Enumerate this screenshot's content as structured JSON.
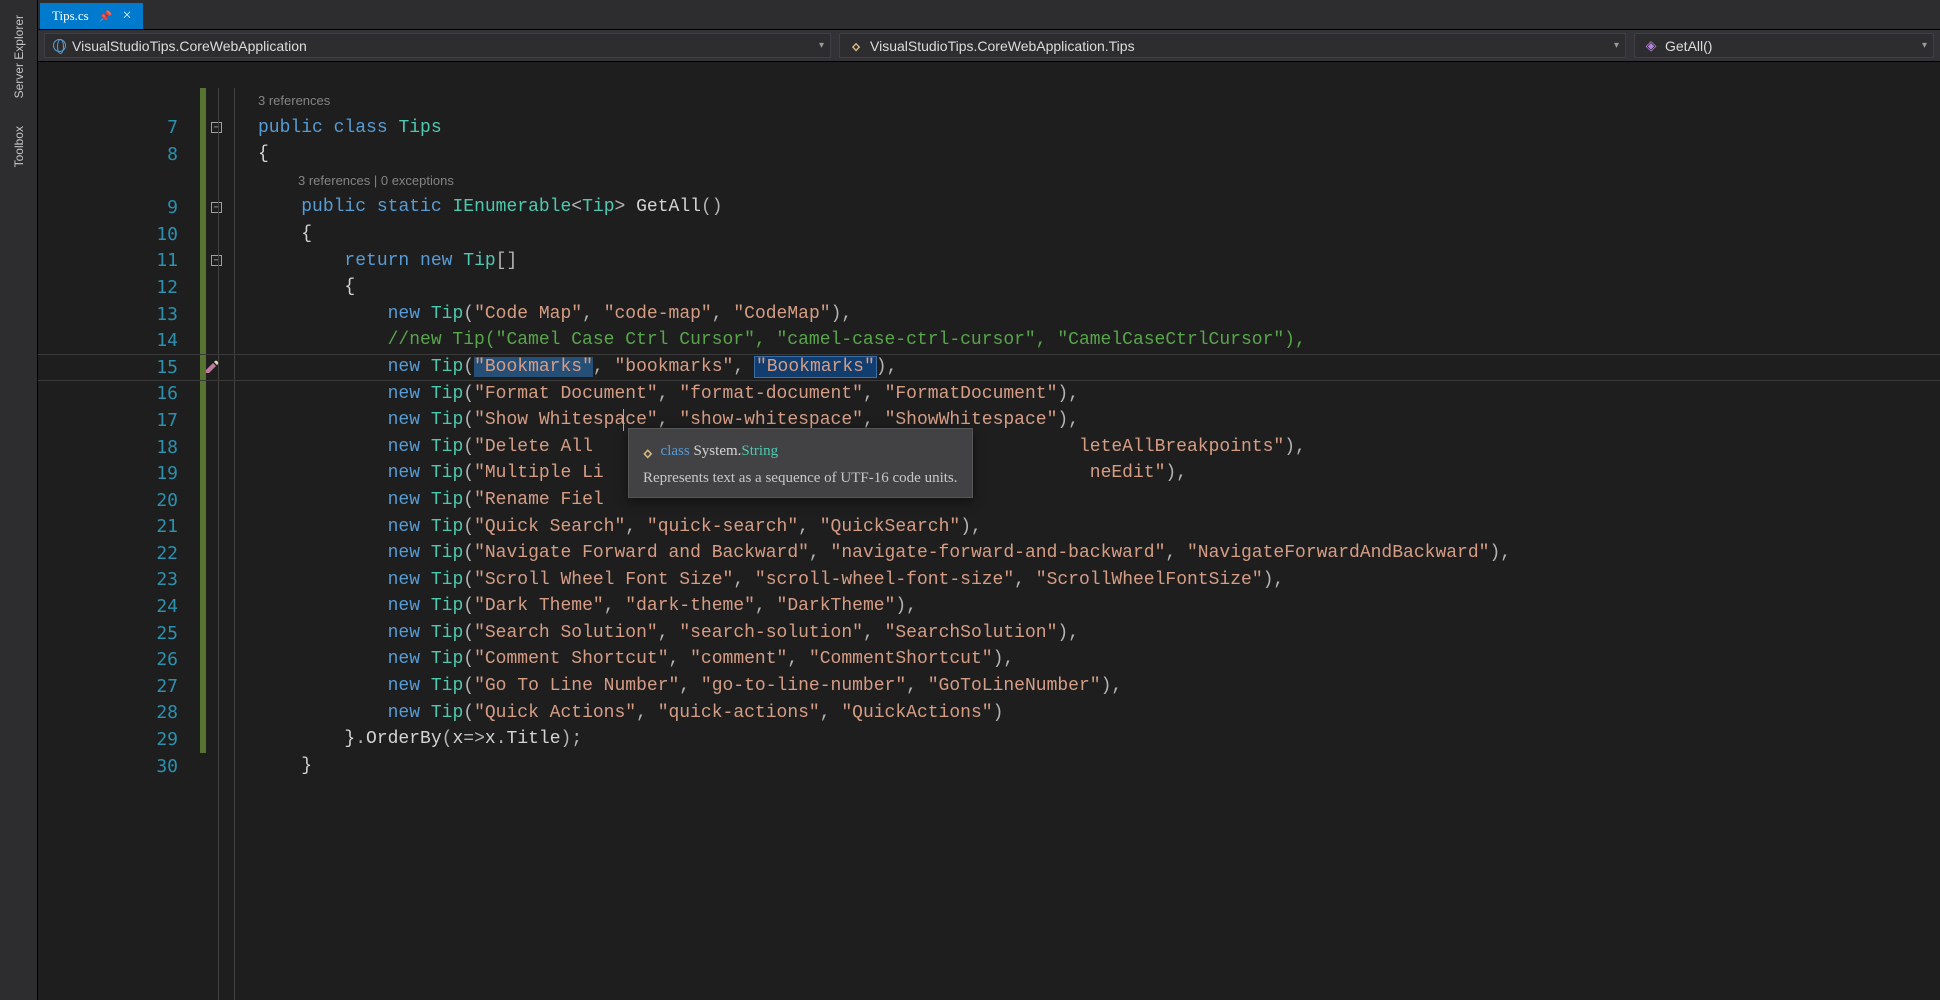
{
  "siderail": {
    "tabs": [
      {
        "label": "Server Explorer",
        "active": false
      },
      {
        "label": "Toolbox",
        "active": false
      }
    ]
  },
  "tabstrip": {
    "active_tab": {
      "label": "Tips.cs",
      "pinned": true
    }
  },
  "breadcrumbs": {
    "project": "VisualStudioTips.CoreWebApplication",
    "class": "VisualStudioTips.CoreWebApplication.Tips",
    "member": "GetAll()"
  },
  "codelens": {
    "class": "3 references",
    "method": "3 references | 0 exceptions"
  },
  "tooltip": {
    "kind": "class",
    "namespace": "System.",
    "typename": "String",
    "description": "Represents text as a sequence of UTF-16 code units."
  },
  "editor": {
    "first_line_number": 7,
    "current_line": 15,
    "highlighted_word": "\"Bookmarks\"",
    "lines": [
      {
        "n": 7,
        "fold": true,
        "codelens": "class",
        "tokens": [
          [
            "kw",
            "public"
          ],
          [
            "w",
            " "
          ],
          [
            "kw",
            "class"
          ],
          [
            "w",
            " "
          ],
          [
            "ty",
            "Tips"
          ]
        ]
      },
      {
        "n": 8,
        "tokens": [
          [
            "w",
            "{"
          ]
        ]
      },
      {
        "n": 9,
        "fold": true,
        "codelens": "method",
        "tokens": [
          [
            "w",
            "    "
          ],
          [
            "kw",
            "public"
          ],
          [
            "w",
            " "
          ],
          [
            "kw",
            "static"
          ],
          [
            "w",
            " "
          ],
          [
            "ty",
            "IEnumerable"
          ],
          [
            "p",
            "<"
          ],
          [
            "ty",
            "Tip"
          ],
          [
            "p",
            ">"
          ],
          [
            "w",
            " GetAll"
          ],
          [
            "p",
            "()"
          ]
        ]
      },
      {
        "n": 10,
        "tokens": [
          [
            "w",
            "    {"
          ]
        ]
      },
      {
        "n": 11,
        "fold": true,
        "tokens": [
          [
            "w",
            "        "
          ],
          [
            "kw",
            "return"
          ],
          [
            "w",
            " "
          ],
          [
            "kw",
            "new"
          ],
          [
            "w",
            " "
          ],
          [
            "ty",
            "Tip"
          ],
          [
            "p",
            "[]"
          ]
        ]
      },
      {
        "n": 12,
        "tokens": [
          [
            "w",
            "        {"
          ]
        ]
      },
      {
        "n": 13,
        "tokens": [
          [
            "w",
            "            "
          ],
          [
            "kw",
            "new"
          ],
          [
            "w",
            " "
          ],
          [
            "ty",
            "Tip"
          ],
          [
            "p",
            "("
          ],
          [
            "st",
            "\"Code Map\""
          ],
          [
            "p",
            ", "
          ],
          [
            "st",
            "\"code-map\""
          ],
          [
            "p",
            ", "
          ],
          [
            "st",
            "\"CodeMap\""
          ],
          [
            "p",
            "),"
          ]
        ]
      },
      {
        "n": 14,
        "tokens": [
          [
            "w",
            "            "
          ],
          [
            "cm",
            "//new Tip(\"Camel Case Ctrl Cursor\", \"camel-case-ctrl-cursor\", \"CamelCaseCtrlCursor\"),"
          ]
        ]
      },
      {
        "n": 15,
        "marker": "edit",
        "tokens": [
          [
            "w",
            "            "
          ],
          [
            "kw",
            "new"
          ],
          [
            "w",
            " "
          ],
          [
            "ty",
            "Tip"
          ],
          [
            "p",
            "("
          ],
          [
            "sel",
            "\"Bookmarks\""
          ],
          [
            "p",
            ", "
          ],
          [
            "st",
            "\"bookmarks\""
          ],
          [
            "p",
            ", "
          ],
          [
            "hiword",
            "\"Bookmarks\""
          ],
          [
            "p",
            "),"
          ]
        ]
      },
      {
        "n": 16,
        "tokens": [
          [
            "w",
            "            "
          ],
          [
            "kw",
            "new"
          ],
          [
            "w",
            " "
          ],
          [
            "ty",
            "Tip"
          ],
          [
            "p",
            "("
          ],
          [
            "st",
            "\"Format Document\""
          ],
          [
            "p",
            ", "
          ],
          [
            "st",
            "\"format-document\""
          ],
          [
            "p",
            ", "
          ],
          [
            "st",
            "\"FormatDocument\""
          ],
          [
            "p",
            "),"
          ]
        ]
      },
      {
        "n": 17,
        "tokens": [
          [
            "w",
            "            "
          ],
          [
            "kw",
            "new"
          ],
          [
            "w",
            " "
          ],
          [
            "ty",
            "Tip"
          ],
          [
            "p",
            "("
          ],
          [
            "st",
            "\"Show Whitespace\""
          ],
          [
            "p",
            ", "
          ],
          [
            "st",
            "\"show-whitespace\""
          ],
          [
            "p",
            ", "
          ],
          [
            "st",
            "\"ShowWhitespace\""
          ],
          [
            "p",
            "),"
          ]
        ]
      },
      {
        "n": 18,
        "tokens": [
          [
            "w",
            "            "
          ],
          [
            "kw",
            "new"
          ],
          [
            "w",
            " "
          ],
          [
            "ty",
            "Tip"
          ],
          [
            "p",
            "("
          ],
          [
            "st",
            "\"Delete All "
          ],
          [
            "w",
            "                                            "
          ],
          [
            "st",
            "leteAllBreakpoints\""
          ],
          [
            "p",
            "),"
          ]
        ]
      },
      {
        "n": 19,
        "tokens": [
          [
            "w",
            "            "
          ],
          [
            "kw",
            "new"
          ],
          [
            "w",
            " "
          ],
          [
            "ty",
            "Tip"
          ],
          [
            "p",
            "("
          ],
          [
            "st",
            "\"Multiple Li"
          ],
          [
            "w",
            "                                             "
          ],
          [
            "st",
            "neEdit\""
          ],
          [
            "p",
            "),"
          ]
        ]
      },
      {
        "n": 20,
        "tokens": [
          [
            "w",
            "            "
          ],
          [
            "kw",
            "new"
          ],
          [
            "w",
            " "
          ],
          [
            "ty",
            "Tip"
          ],
          [
            "p",
            "("
          ],
          [
            "st",
            "\"Rename Fiel"
          ]
        ]
      },
      {
        "n": 21,
        "tokens": [
          [
            "w",
            "            "
          ],
          [
            "kw",
            "new"
          ],
          [
            "w",
            " "
          ],
          [
            "ty",
            "Tip"
          ],
          [
            "p",
            "("
          ],
          [
            "st",
            "\"Quick Search\""
          ],
          [
            "p",
            ", "
          ],
          [
            "st",
            "\"quick-search\""
          ],
          [
            "p",
            ", "
          ],
          [
            "st",
            "\"QuickSearch\""
          ],
          [
            "p",
            "),"
          ]
        ]
      },
      {
        "n": 22,
        "tokens": [
          [
            "w",
            "            "
          ],
          [
            "kw",
            "new"
          ],
          [
            "w",
            " "
          ],
          [
            "ty",
            "Tip"
          ],
          [
            "p",
            "("
          ],
          [
            "st",
            "\"Navigate Forward and Backward\""
          ],
          [
            "p",
            ", "
          ],
          [
            "st",
            "\"navigate-forward-and-backward\""
          ],
          [
            "p",
            ", "
          ],
          [
            "st",
            "\"NavigateForwardAndBackward\""
          ],
          [
            "p",
            "),"
          ]
        ]
      },
      {
        "n": 23,
        "tokens": [
          [
            "w",
            "            "
          ],
          [
            "kw",
            "new"
          ],
          [
            "w",
            " "
          ],
          [
            "ty",
            "Tip"
          ],
          [
            "p",
            "("
          ],
          [
            "st",
            "\"Scroll Wheel Font Size\""
          ],
          [
            "p",
            ", "
          ],
          [
            "st",
            "\"scroll-wheel-font-size\""
          ],
          [
            "p",
            ", "
          ],
          [
            "st",
            "\"ScrollWheelFontSize\""
          ],
          [
            "p",
            "),"
          ]
        ]
      },
      {
        "n": 24,
        "tokens": [
          [
            "w",
            "            "
          ],
          [
            "kw",
            "new"
          ],
          [
            "w",
            " "
          ],
          [
            "ty",
            "Tip"
          ],
          [
            "p",
            "("
          ],
          [
            "st",
            "\"Dark Theme\""
          ],
          [
            "p",
            ", "
          ],
          [
            "st",
            "\"dark-theme\""
          ],
          [
            "p",
            ", "
          ],
          [
            "st",
            "\"DarkTheme\""
          ],
          [
            "p",
            "),"
          ]
        ]
      },
      {
        "n": 25,
        "tokens": [
          [
            "w",
            "            "
          ],
          [
            "kw",
            "new"
          ],
          [
            "w",
            " "
          ],
          [
            "ty",
            "Tip"
          ],
          [
            "p",
            "("
          ],
          [
            "st",
            "\"Search Solution\""
          ],
          [
            "p",
            ", "
          ],
          [
            "st",
            "\"search-solution\""
          ],
          [
            "p",
            ", "
          ],
          [
            "st",
            "\"SearchSolution\""
          ],
          [
            "p",
            "),"
          ]
        ]
      },
      {
        "n": 26,
        "tokens": [
          [
            "w",
            "            "
          ],
          [
            "kw",
            "new"
          ],
          [
            "w",
            " "
          ],
          [
            "ty",
            "Tip"
          ],
          [
            "p",
            "("
          ],
          [
            "st",
            "\"Comment Shortcut\""
          ],
          [
            "p",
            ", "
          ],
          [
            "st",
            "\"comment\""
          ],
          [
            "p",
            ", "
          ],
          [
            "st",
            "\"CommentShortcut\""
          ],
          [
            "p",
            "),"
          ]
        ]
      },
      {
        "n": 27,
        "tokens": [
          [
            "w",
            "            "
          ],
          [
            "kw",
            "new"
          ],
          [
            "w",
            " "
          ],
          [
            "ty",
            "Tip"
          ],
          [
            "p",
            "("
          ],
          [
            "st",
            "\"Go To Line Number\""
          ],
          [
            "p",
            ", "
          ],
          [
            "st",
            "\"go-to-line-number\""
          ],
          [
            "p",
            ", "
          ],
          [
            "st",
            "\"GoToLineNumber\""
          ],
          [
            "p",
            "),"
          ]
        ]
      },
      {
        "n": 28,
        "tokens": [
          [
            "w",
            "            "
          ],
          [
            "kw",
            "new"
          ],
          [
            "w",
            " "
          ],
          [
            "ty",
            "Tip"
          ],
          [
            "p",
            "("
          ],
          [
            "st",
            "\"Quick Actions\""
          ],
          [
            "p",
            ", "
          ],
          [
            "st",
            "\"quick-actions\""
          ],
          [
            "p",
            ", "
          ],
          [
            "st",
            "\"QuickActions\""
          ],
          [
            "p",
            ")"
          ]
        ]
      },
      {
        "n": 29,
        "tokens": [
          [
            "w",
            "        }"
          ],
          [
            "p",
            "."
          ],
          [
            "w",
            "OrderBy"
          ],
          [
            "p",
            "("
          ],
          [
            "w",
            "x"
          ],
          [
            "p",
            "=>"
          ],
          [
            "w",
            "x"
          ],
          [
            "p",
            "."
          ],
          [
            "w",
            "Title"
          ],
          [
            "p",
            ");"
          ]
        ]
      },
      {
        "n": 30,
        "tokens": [
          [
            "w",
            "    }"
          ]
        ]
      }
    ]
  }
}
